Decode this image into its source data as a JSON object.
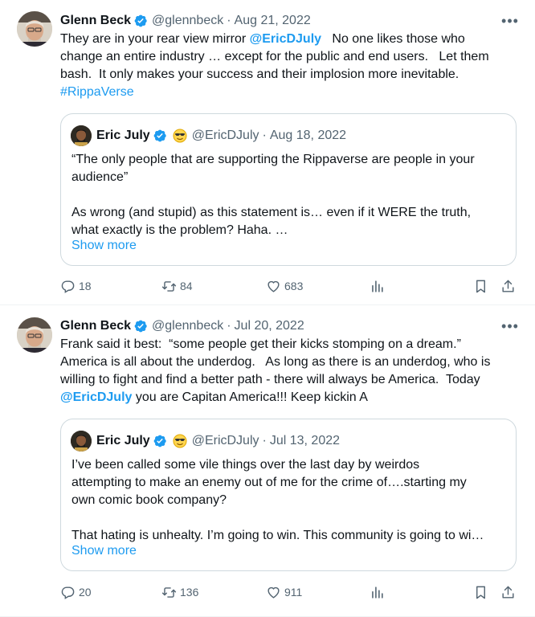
{
  "tweets": [
    {
      "author": {
        "name": "Glenn Beck",
        "handle": "@glennbeck",
        "date": "Aug 21, 2022"
      },
      "text": {
        "l1a": "They are in your rear view mirror ",
        "l1_mention": "@EricDJuly",
        "l1b": "   No one likes those who",
        "l2": "change an entire industry … except for the public and end users.   Let them",
        "l3": "bash.  It only makes your success and their implosion more inevitable.",
        "hashtag": "#RippaVerse"
      },
      "quote": {
        "name": "Eric July",
        "handle": "@EricDJuly",
        "date": "Aug 18, 2022",
        "l1": "“The only people that are supporting the Rippaverse are people in your",
        "l2": "audience”",
        "l3": "As wrong (and stupid) as this statement is… even if it WERE the truth,",
        "l4": "what exactly is the problem? Haha. …",
        "show_more": "Show more"
      },
      "stats": {
        "replies": "18",
        "retweets": "84",
        "likes": "683"
      }
    },
    {
      "author": {
        "name": "Glenn Beck",
        "handle": "@glennbeck",
        "date": "Jul 20, 2022"
      },
      "text": {
        "l1": "Frank said it best:  “some people get their kicks stomping on a dream.”",
        "l2": "America is all about the underdog.   As long as there is an underdog, who is",
        "l3": "willing to fight and find a better path - there will always be America.  Today",
        "l4_mention": "@EricDJuly",
        "l4b": " you are Capitan America!!! Keep kickin A"
      },
      "quote": {
        "name": "Eric July",
        "handle": "@EricDJuly",
        "date": "Jul 13, 2022",
        "l1": "I’ve been called some vile things over the last day by weirdos",
        "l2": "attempting to make an enemy out of me for the crime of….starting my",
        "l3": "own comic book company?",
        "l4": "That hating is unhealty. I’m going to win. This community is going to wi…",
        "show_more": "Show more"
      },
      "stats": {
        "replies": "20",
        "retweets": "136",
        "likes": "911"
      }
    }
  ],
  "icons": {
    "more": "more-icon",
    "verified": "verified-badge-icon",
    "reply": "reply-icon",
    "retweet": "retweet-icon",
    "like": "heart-icon",
    "views": "views-icon",
    "bookmark": "bookmark-icon",
    "share": "share-icon"
  },
  "colors": {
    "accent": "#1d9bf0",
    "muted": "#536471",
    "border": "#cfd9de"
  }
}
